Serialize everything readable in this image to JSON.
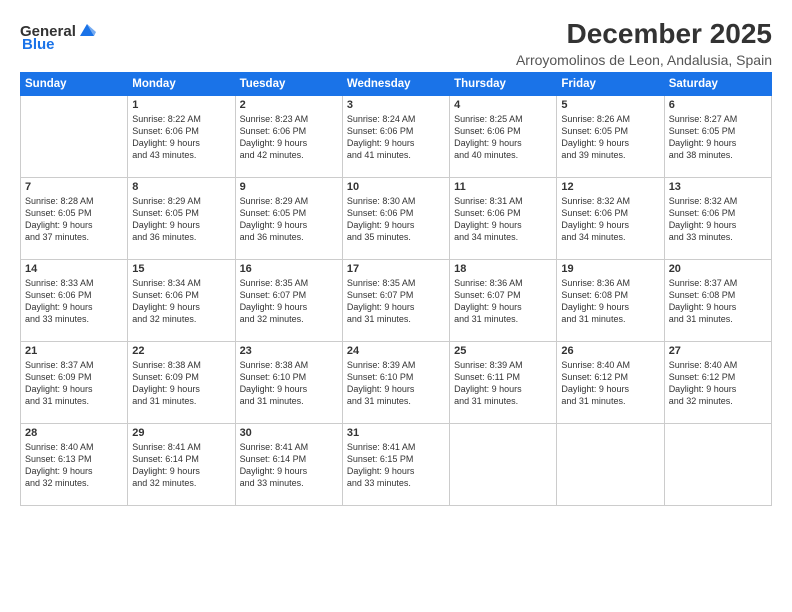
{
  "logo": {
    "general": "General",
    "blue": "Blue"
  },
  "title": "December 2025",
  "subtitle": "Arroyomolinos de Leon, Andalusia, Spain",
  "calendar": {
    "headers": [
      "Sunday",
      "Monday",
      "Tuesday",
      "Wednesday",
      "Thursday",
      "Friday",
      "Saturday"
    ],
    "weeks": [
      [
        {
          "day": "",
          "text": ""
        },
        {
          "day": "1",
          "text": "Sunrise: 8:22 AM\nSunset: 6:06 PM\nDaylight: 9 hours\nand 43 minutes."
        },
        {
          "day": "2",
          "text": "Sunrise: 8:23 AM\nSunset: 6:06 PM\nDaylight: 9 hours\nand 42 minutes."
        },
        {
          "day": "3",
          "text": "Sunrise: 8:24 AM\nSunset: 6:06 PM\nDaylight: 9 hours\nand 41 minutes."
        },
        {
          "day": "4",
          "text": "Sunrise: 8:25 AM\nSunset: 6:06 PM\nDaylight: 9 hours\nand 40 minutes."
        },
        {
          "day": "5",
          "text": "Sunrise: 8:26 AM\nSunset: 6:05 PM\nDaylight: 9 hours\nand 39 minutes."
        },
        {
          "day": "6",
          "text": "Sunrise: 8:27 AM\nSunset: 6:05 PM\nDaylight: 9 hours\nand 38 minutes."
        }
      ],
      [
        {
          "day": "7",
          "text": "Sunrise: 8:28 AM\nSunset: 6:05 PM\nDaylight: 9 hours\nand 37 minutes."
        },
        {
          "day": "8",
          "text": "Sunrise: 8:29 AM\nSunset: 6:05 PM\nDaylight: 9 hours\nand 36 minutes."
        },
        {
          "day": "9",
          "text": "Sunrise: 8:29 AM\nSunset: 6:05 PM\nDaylight: 9 hours\nand 36 minutes."
        },
        {
          "day": "10",
          "text": "Sunrise: 8:30 AM\nSunset: 6:06 PM\nDaylight: 9 hours\nand 35 minutes."
        },
        {
          "day": "11",
          "text": "Sunrise: 8:31 AM\nSunset: 6:06 PM\nDaylight: 9 hours\nand 34 minutes."
        },
        {
          "day": "12",
          "text": "Sunrise: 8:32 AM\nSunset: 6:06 PM\nDaylight: 9 hours\nand 34 minutes."
        },
        {
          "day": "13",
          "text": "Sunrise: 8:32 AM\nSunset: 6:06 PM\nDaylight: 9 hours\nand 33 minutes."
        }
      ],
      [
        {
          "day": "14",
          "text": "Sunrise: 8:33 AM\nSunset: 6:06 PM\nDaylight: 9 hours\nand 33 minutes."
        },
        {
          "day": "15",
          "text": "Sunrise: 8:34 AM\nSunset: 6:06 PM\nDaylight: 9 hours\nand 32 minutes."
        },
        {
          "day": "16",
          "text": "Sunrise: 8:35 AM\nSunset: 6:07 PM\nDaylight: 9 hours\nand 32 minutes."
        },
        {
          "day": "17",
          "text": "Sunrise: 8:35 AM\nSunset: 6:07 PM\nDaylight: 9 hours\nand 31 minutes."
        },
        {
          "day": "18",
          "text": "Sunrise: 8:36 AM\nSunset: 6:07 PM\nDaylight: 9 hours\nand 31 minutes."
        },
        {
          "day": "19",
          "text": "Sunrise: 8:36 AM\nSunset: 6:08 PM\nDaylight: 9 hours\nand 31 minutes."
        },
        {
          "day": "20",
          "text": "Sunrise: 8:37 AM\nSunset: 6:08 PM\nDaylight: 9 hours\nand 31 minutes."
        }
      ],
      [
        {
          "day": "21",
          "text": "Sunrise: 8:37 AM\nSunset: 6:09 PM\nDaylight: 9 hours\nand 31 minutes."
        },
        {
          "day": "22",
          "text": "Sunrise: 8:38 AM\nSunset: 6:09 PM\nDaylight: 9 hours\nand 31 minutes."
        },
        {
          "day": "23",
          "text": "Sunrise: 8:38 AM\nSunset: 6:10 PM\nDaylight: 9 hours\nand 31 minutes."
        },
        {
          "day": "24",
          "text": "Sunrise: 8:39 AM\nSunset: 6:10 PM\nDaylight: 9 hours\nand 31 minutes."
        },
        {
          "day": "25",
          "text": "Sunrise: 8:39 AM\nSunset: 6:11 PM\nDaylight: 9 hours\nand 31 minutes."
        },
        {
          "day": "26",
          "text": "Sunrise: 8:40 AM\nSunset: 6:12 PM\nDaylight: 9 hours\nand 31 minutes."
        },
        {
          "day": "27",
          "text": "Sunrise: 8:40 AM\nSunset: 6:12 PM\nDaylight: 9 hours\nand 32 minutes."
        }
      ],
      [
        {
          "day": "28",
          "text": "Sunrise: 8:40 AM\nSunset: 6:13 PM\nDaylight: 9 hours\nand 32 minutes."
        },
        {
          "day": "29",
          "text": "Sunrise: 8:41 AM\nSunset: 6:14 PM\nDaylight: 9 hours\nand 32 minutes."
        },
        {
          "day": "30",
          "text": "Sunrise: 8:41 AM\nSunset: 6:14 PM\nDaylight: 9 hours\nand 33 minutes."
        },
        {
          "day": "31",
          "text": "Sunrise: 8:41 AM\nSunset: 6:15 PM\nDaylight: 9 hours\nand 33 minutes."
        },
        {
          "day": "",
          "text": ""
        },
        {
          "day": "",
          "text": ""
        },
        {
          "day": "",
          "text": ""
        }
      ]
    ]
  }
}
